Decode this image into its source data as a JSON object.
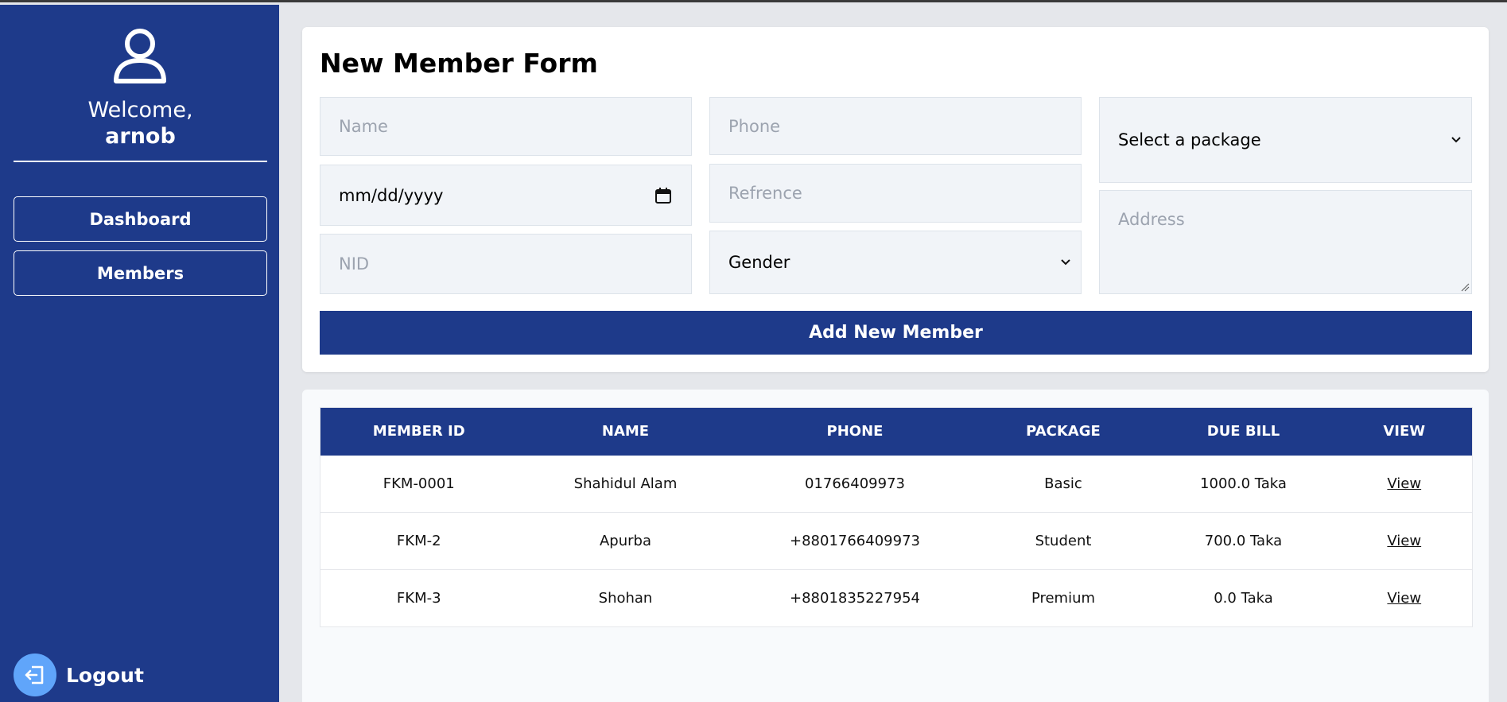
{
  "sidebar": {
    "welcome": "Welcome,",
    "username": "arnob",
    "nav": [
      {
        "label": "Dashboard"
      },
      {
        "label": "Members"
      }
    ],
    "logout": "Logout"
  },
  "form": {
    "title": "New Member Form",
    "name_placeholder": "Name",
    "date_placeholder": "mm/dd/yyyy",
    "nid_placeholder": "NID",
    "phone_placeholder": "Phone",
    "reference_placeholder": "Refrence",
    "gender_selected": "Gender",
    "package_selected": "Select a package",
    "address_placeholder": "Address",
    "submit_label": "Add New Member"
  },
  "table": {
    "headers": [
      "MEMBER ID",
      "NAME",
      "PHONE",
      "PACKAGE",
      "DUE BILL",
      "VIEW"
    ],
    "rows": [
      {
        "id": "FKM-0001",
        "name": "Shahidul Alam",
        "phone": "01766409973",
        "package": "Basic",
        "due": "1000.0 Taka",
        "view": "View"
      },
      {
        "id": "FKM-2",
        "name": "Apurba",
        "phone": "+8801766409973",
        "package": "Student",
        "due": "700.0 Taka",
        "view": "View"
      },
      {
        "id": "FKM-3",
        "name": "Shohan",
        "phone": "+8801835227954",
        "package": "Premium",
        "due": "0.0 Taka",
        "view": "View"
      }
    ]
  },
  "colors": {
    "primary": "#1e3a8a",
    "logout_accent": "#60a5fa",
    "page_bg": "#e5e7eb",
    "field_bg": "#f1f4f8"
  },
  "icons": [
    "user-icon",
    "calendar-icon",
    "chevron-down-icon",
    "logout-icon",
    "resize-grip-icon"
  ]
}
